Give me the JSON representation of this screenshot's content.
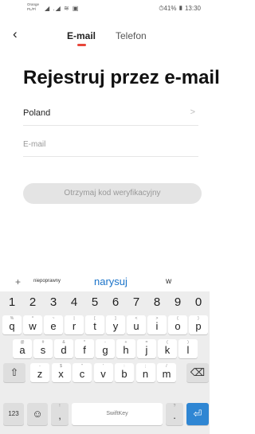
{
  "status_bar": {
    "carrier": "Orange PL/Pl",
    "signals": "◢ .◢ ≋ ▣",
    "right": "⏱41% ▮ 13:30"
  },
  "header": {
    "back_icon": "back-chevron-icon",
    "tabs": [
      {
        "label": "E-mail",
        "active": true
      },
      {
        "label": "Telefon",
        "active": false
      }
    ],
    "accent_color": "#e8463a"
  },
  "title": "Rejestruj przez e-mail",
  "country": {
    "value": "Poland",
    "chevron": ">"
  },
  "email": {
    "placeholder": "E-mail",
    "value": ""
  },
  "verify_button": {
    "label": "Otrzymaj kod weryfikacyjny"
  },
  "keyboard": {
    "suggestions": {
      "plus": "+",
      "left": "niepoprawny",
      "middle": "narysuj",
      "right": "w"
    },
    "numbers": [
      "1",
      "2",
      "3",
      "4",
      "5",
      "6",
      "7",
      "8",
      "9",
      "0"
    ],
    "row1": [
      {
        "key": "q",
        "hint": "%"
      },
      {
        "key": "w",
        "hint": "^"
      },
      {
        "key": "e",
        "hint": "~"
      },
      {
        "key": "r",
        "hint": "|"
      },
      {
        "key": "t",
        "hint": "["
      },
      {
        "key": "y",
        "hint": "]"
      },
      {
        "key": "u",
        "hint": "<"
      },
      {
        "key": "i",
        "hint": ">"
      },
      {
        "key": "o",
        "hint": "{"
      },
      {
        "key": "p",
        "hint": "}"
      }
    ],
    "row2": [
      {
        "key": "a",
        "hint": "@"
      },
      {
        "key": "s",
        "hint": "#"
      },
      {
        "key": "d",
        "hint": "&"
      },
      {
        "key": "f",
        "hint": "*"
      },
      {
        "key": "g",
        "hint": "-"
      },
      {
        "key": "h",
        "hint": "+"
      },
      {
        "key": "j",
        "hint": "="
      },
      {
        "key": "k",
        "hint": "("
      },
      {
        "key": "l",
        "hint": ")"
      }
    ],
    "row3": [
      {
        "key": "z",
        "hint": "-"
      },
      {
        "key": "x",
        "hint": "$"
      },
      {
        "key": "c",
        "hint": "\""
      },
      {
        "key": "v",
        "hint": "'"
      },
      {
        "key": "b",
        "hint": ":"
      },
      {
        "key": "n",
        "hint": ";"
      },
      {
        "key": "m",
        "hint": "/"
      }
    ],
    "shift": "⇧",
    "backspace": "⌫",
    "symbols": "123",
    "emoji": "☺",
    "comma": ",",
    "comma_hint": "!",
    "space": "SwiftKey",
    "period": ".",
    "period_hint": "?",
    "enter": "⏎",
    "enter_color": "#2f86d3"
  }
}
